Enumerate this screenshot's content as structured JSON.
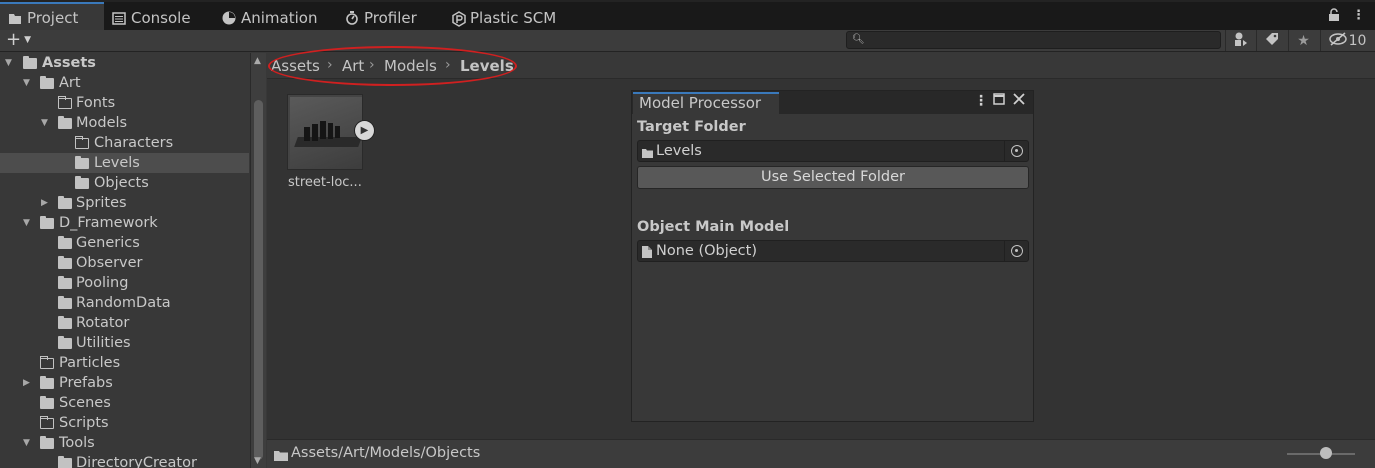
{
  "tabs": [
    {
      "label": "Project",
      "icon": "folder-icon",
      "active": true
    },
    {
      "label": "Console",
      "icon": "console-icon",
      "active": false
    },
    {
      "label": "Animation",
      "icon": "animation-icon",
      "active": false
    },
    {
      "label": "Profiler",
      "icon": "profiler-icon",
      "active": false
    },
    {
      "label": "Plastic SCM",
      "icon": "plastic-scm-icon",
      "active": false
    }
  ],
  "toolbar": {
    "add_symbol": "+",
    "search_placeholder": "",
    "hidden_count": "10"
  },
  "tree": {
    "items": [
      {
        "label": "Assets"
      },
      {
        "label": "Art"
      },
      {
        "label": "Fonts"
      },
      {
        "label": "Models"
      },
      {
        "label": "Characters"
      },
      {
        "label": "Levels"
      },
      {
        "label": "Objects"
      },
      {
        "label": "Sprites"
      },
      {
        "label": "D_Framework"
      },
      {
        "label": "Generics"
      },
      {
        "label": "Observer"
      },
      {
        "label": "Pooling"
      },
      {
        "label": "RandomData"
      },
      {
        "label": "Rotator"
      },
      {
        "label": "Utilities"
      },
      {
        "label": "Particles"
      },
      {
        "label": "Prefabs"
      },
      {
        "label": "Scenes"
      },
      {
        "label": "Scripts"
      },
      {
        "label": "Tools"
      },
      {
        "label": "DirectoryCreator"
      }
    ]
  },
  "breadcrumb": [
    "Assets",
    "Art",
    "Models",
    "Levels"
  ],
  "asset": {
    "name": "street-loc..."
  },
  "model_processor": {
    "title": "Model Processor",
    "target_folder_label": "Target Folder",
    "target_folder_value": "Levels",
    "use_selected_label": "Use Selected Folder",
    "main_model_label": "Object Main Model",
    "main_model_value": "None (Object)"
  },
  "footer": {
    "path": "Assets/Art/Models/Objects"
  },
  "colors": {
    "accent": "#3a79bb",
    "annotation": "#d02020"
  }
}
